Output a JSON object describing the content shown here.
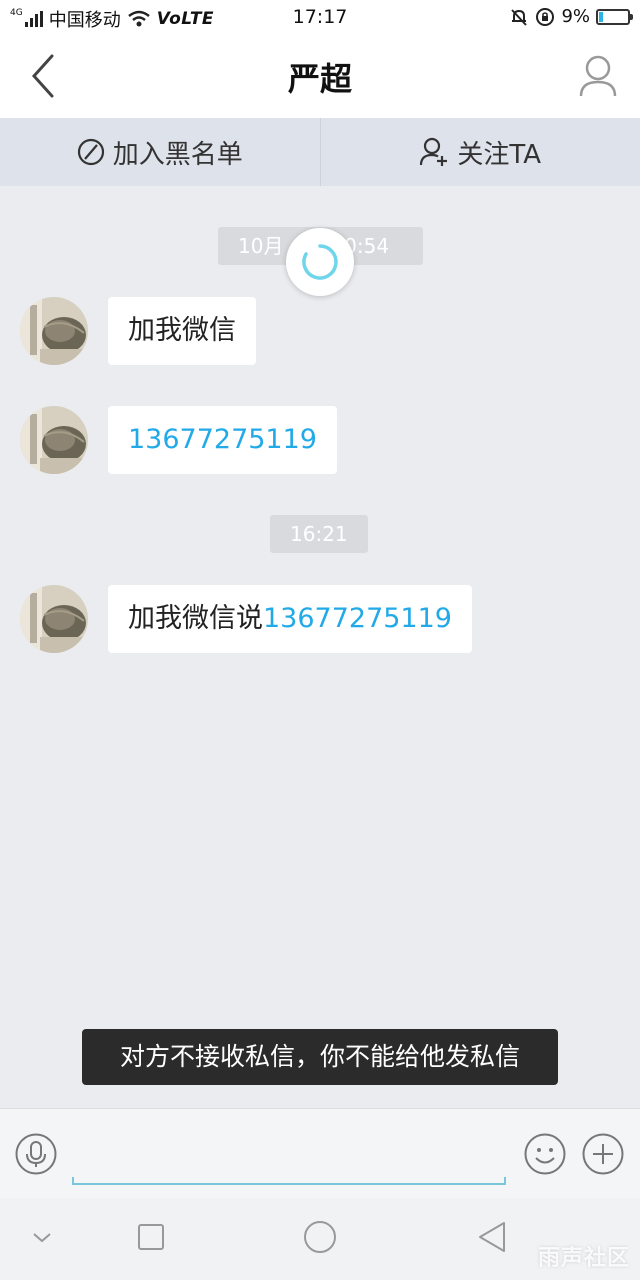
{
  "status_bar": {
    "network_tag": "4G",
    "carrier": "中国移动",
    "volte": "VoLTE",
    "time": "17:17",
    "battery_text": "9%",
    "battery_level": 0.09
  },
  "header": {
    "title": "严超"
  },
  "actions": {
    "blacklist_label": "加入黑名单",
    "follow_label": "关注TA"
  },
  "chat": {
    "time_chips": [
      "10月",
      "20:54",
      "16:21"
    ],
    "messages": [
      {
        "text": "加我微信",
        "link": ""
      },
      {
        "text": "",
        "link": "13677275119"
      },
      {
        "text": "加我微信说",
        "link": "13677275119"
      }
    ]
  },
  "toast": {
    "text": "对方不接收私信，你不能给他发私信"
  },
  "input": {
    "value": "",
    "placeholder": ""
  },
  "watermark": "雨声社区",
  "colors": {
    "accent": "#22aae8",
    "chat_bg": "#ebecf0",
    "action_bar_bg": "#dee2ea",
    "toast_bg": "#2b2b2b"
  }
}
